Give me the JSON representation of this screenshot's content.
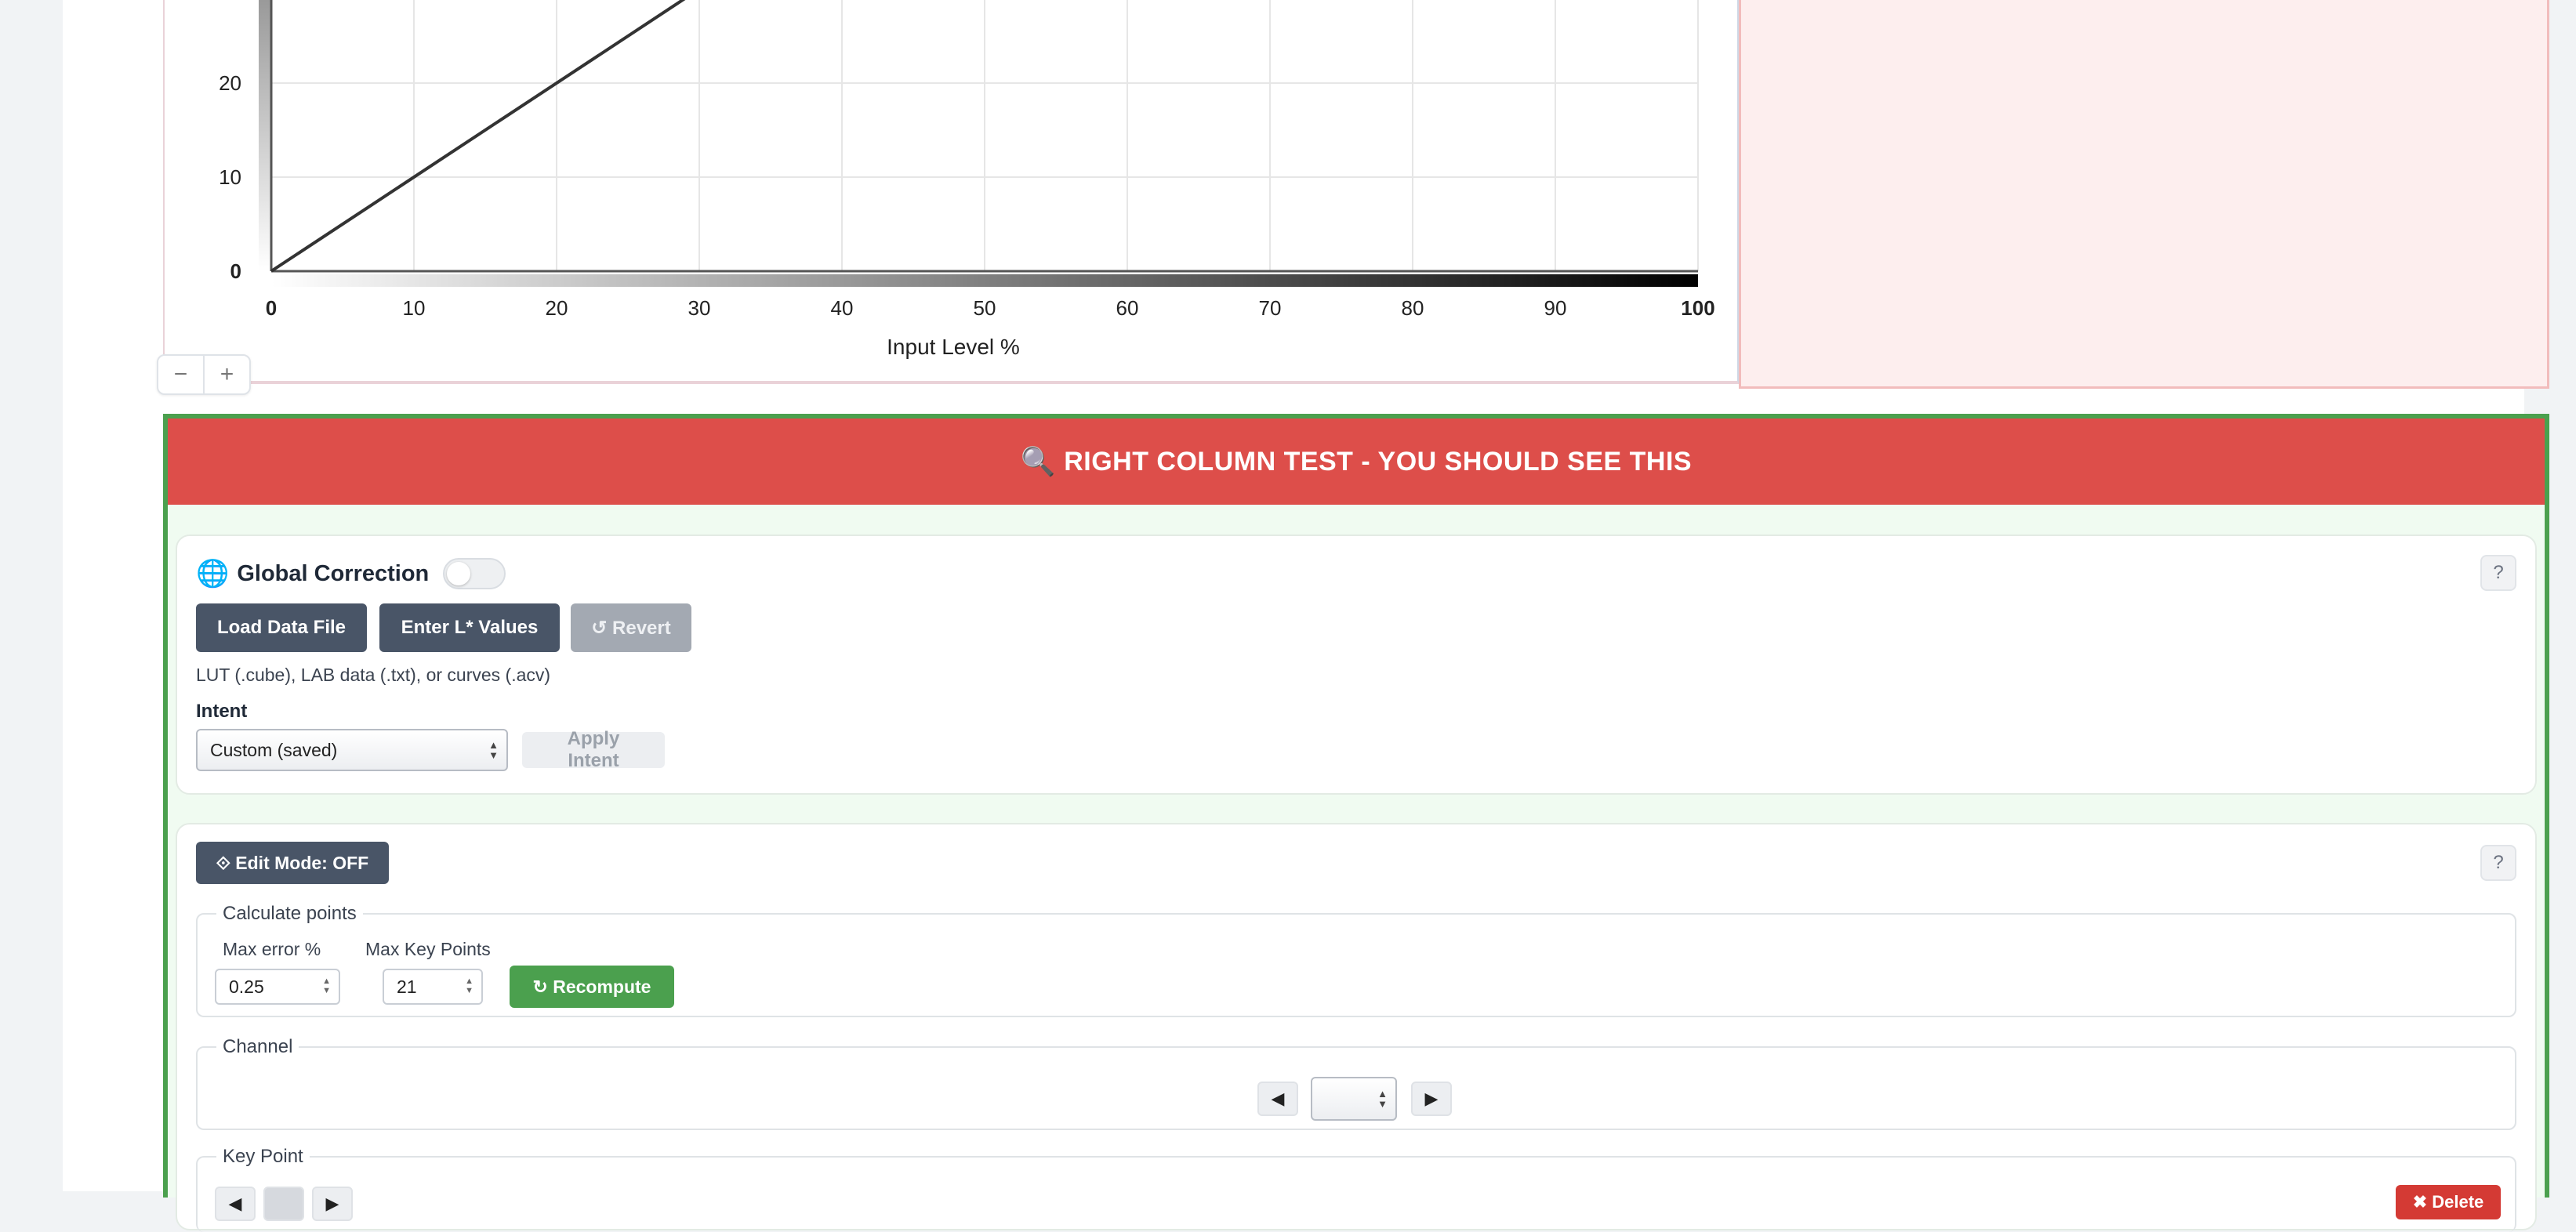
{
  "chart_data": {
    "type": "line",
    "title": "",
    "xlabel": "Input Level %",
    "ylabel": "",
    "x_ticks": [
      0,
      10,
      20,
      30,
      40,
      50,
      60,
      70,
      80,
      90,
      100
    ],
    "y_ticks_visible": [
      0,
      10,
      20
    ],
    "xlim": [
      0,
      100
    ],
    "ylim_visible": [
      0,
      29
    ],
    "grid": true,
    "series": [
      {
        "values_x": [
          0,
          100
        ],
        "values_y": [
          0,
          100
        ]
      }
    ]
  },
  "zoom": {
    "minus": "−",
    "plus": "+"
  },
  "banner": {
    "icon": "🔍",
    "text": "RIGHT COLUMN TEST - YOU SHOULD SEE THIS"
  },
  "global_correction": {
    "icon": "🌐",
    "title": "Global Correction",
    "help": "?",
    "load_button": "Load Data File",
    "enter_button": "Enter L* Values",
    "revert_button": "↺ Revert",
    "hint": "LUT (.cube), LAB data (.txt), or curves (.acv)",
    "intent_label": "Intent",
    "intent_value": "Custom (saved)",
    "apply_button": "Apply Intent"
  },
  "edit": {
    "mode_button": "⟐ Edit Mode: OFF",
    "help": "?",
    "calc_legend": "Calculate points",
    "max_error_label": "Max error %",
    "max_error_value": "0.25",
    "max_points_label": "Max Key Points",
    "max_points_value": "21",
    "recompute_button": "↻ Recompute",
    "channel_legend": "Channel",
    "prev": "◀",
    "next": "▶",
    "channel_value": "",
    "keypoint_legend": "Key Point",
    "delete_button": "✖ Delete"
  }
}
